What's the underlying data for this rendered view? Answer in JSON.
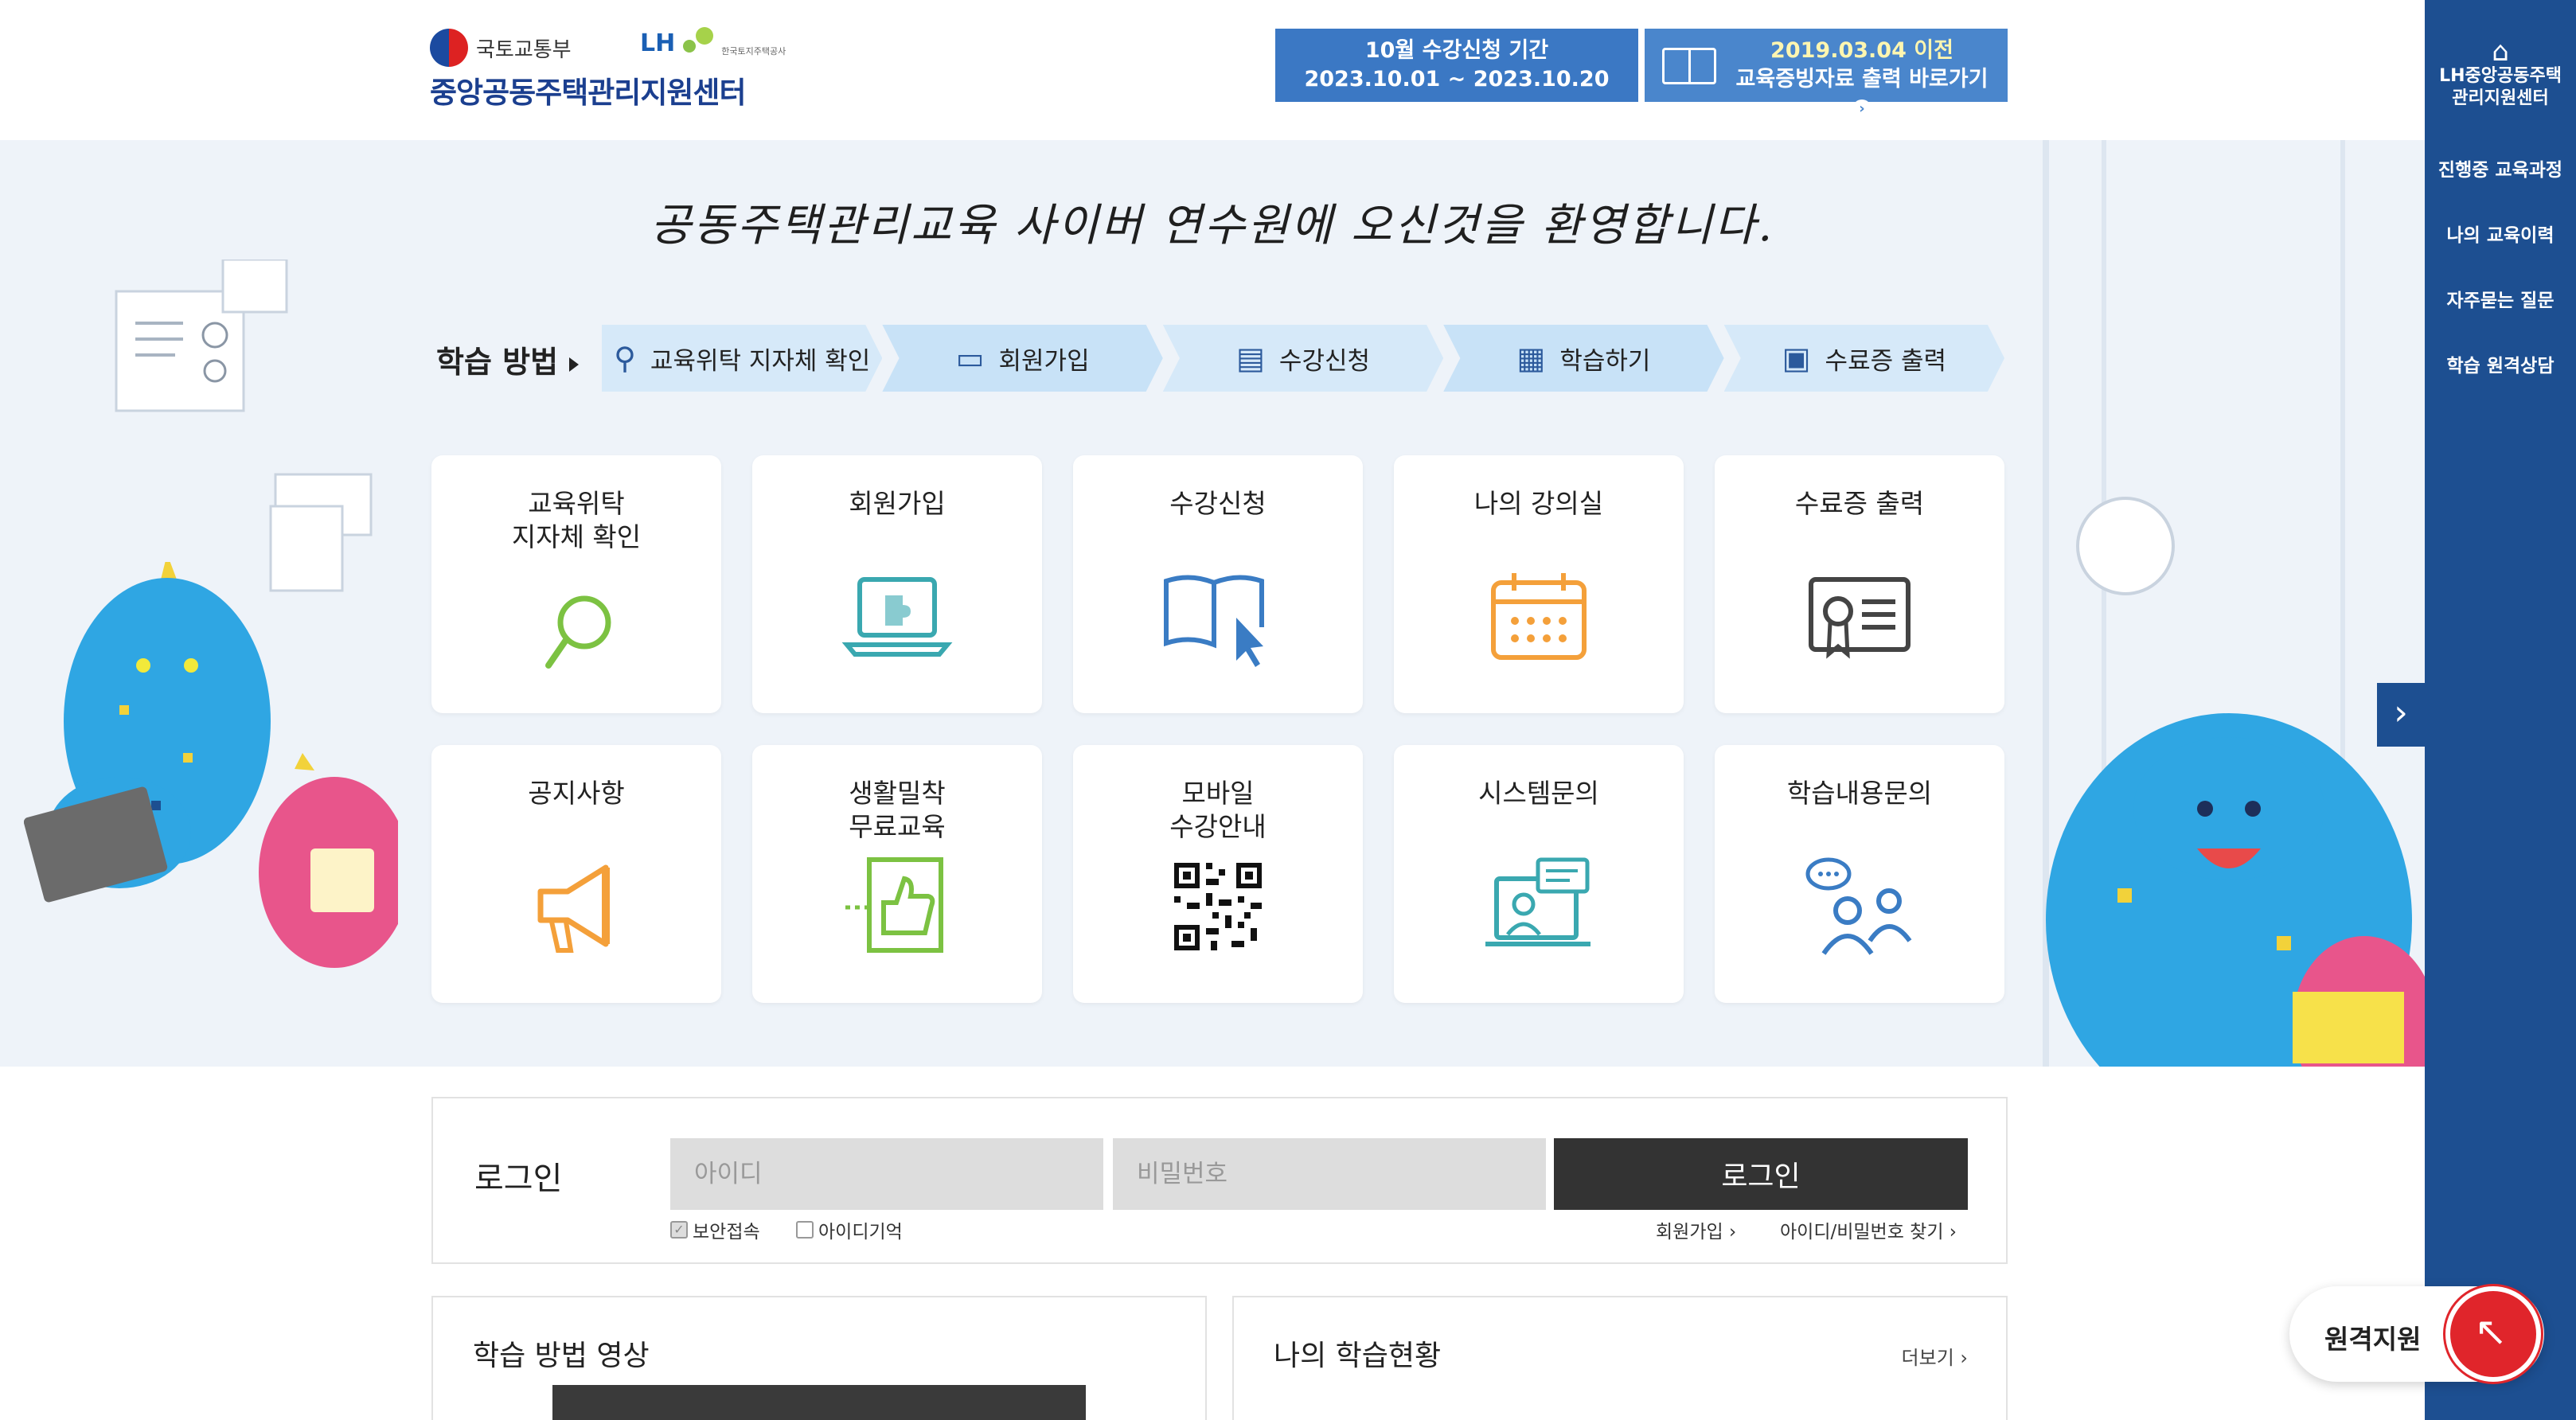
{
  "header": {
    "ministry": "국토교통부",
    "lh_logo": "LH",
    "lh_subtitle": "한국토지주택공사",
    "site_name": "중앙공동주택관리지원센터",
    "banner_period_line1": "10월 수강신청 기간",
    "banner_period_line2": "2023.10.01 ~ 2023.10.20",
    "banner_cert_line1": "2019.03.04 이전",
    "banner_cert_line2": "교육증빙자료 출력 바로가기"
  },
  "hero": {
    "welcome": "공동주택관리교육 사이버 연수원에 오신것을 환영합니다.",
    "steps_label": "학습 방법",
    "steps": [
      {
        "label": "교육위탁 지자체 확인",
        "icon": "search-icon"
      },
      {
        "label": "회원가입",
        "icon": "laptop-icon"
      },
      {
        "label": "수강신청",
        "icon": "book-icon"
      },
      {
        "label": "학습하기",
        "icon": "calendar-icon"
      },
      {
        "label": "수료증 출력",
        "icon": "certificate-icon"
      }
    ],
    "cards": [
      {
        "title": "교육위탁\n지자체 확인",
        "icon": "magnifier-icon",
        "color": "#7cc242"
      },
      {
        "title": "회원가입",
        "icon": "laptop-puzzle-icon",
        "color": "#3aa8b0"
      },
      {
        "title": "수강신청",
        "icon": "book-cursor-icon",
        "color": "#3a7cc4"
      },
      {
        "title": "나의 강의실",
        "icon": "calendar-icon",
        "color": "#f4a03a"
      },
      {
        "title": "수료증 출력",
        "icon": "certificate-icon",
        "color": "#444444"
      },
      {
        "title": "공지사항",
        "icon": "megaphone-icon",
        "color": "#f4a03a"
      },
      {
        "title": "생활밀착\n무료교육",
        "icon": "thumbs-up-icon",
        "color": "#7cc242"
      },
      {
        "title": "모바일\n수강안내",
        "icon": "qr-code-icon",
        "color": "#111111"
      },
      {
        "title": "시스템문의",
        "icon": "video-call-icon",
        "color": "#3aa8b0"
      },
      {
        "title": "학습내용문의",
        "icon": "consultation-icon",
        "color": "#3a7cc4"
      }
    ]
  },
  "login": {
    "title": "로그인",
    "id_placeholder": "아이디",
    "pw_placeholder": "비밀번호",
    "button": "로그인",
    "secure_label": "보안접속",
    "remember_label": "아이디기억",
    "join_link": "회원가입 ›",
    "find_link": "아이디/비밀번호 찾기 ›"
  },
  "panels": {
    "video_title": "학습 방법 영상",
    "status_title": "나의 학습현황",
    "more": "더보기 ›"
  },
  "sidebar": {
    "home_label": "LH중앙공동주택\n관리지원센터",
    "items": [
      "진행중 교육과정",
      "나의 교육이력",
      "자주묻는 질문",
      "학습 원격상담"
    ]
  },
  "remote_support": {
    "label": "원격지원"
  },
  "colors": {
    "sidebar": "#1d4f91",
    "hero_bg": "#eef3f9",
    "banner": "#3b78c4",
    "remote": "#e0252b"
  }
}
